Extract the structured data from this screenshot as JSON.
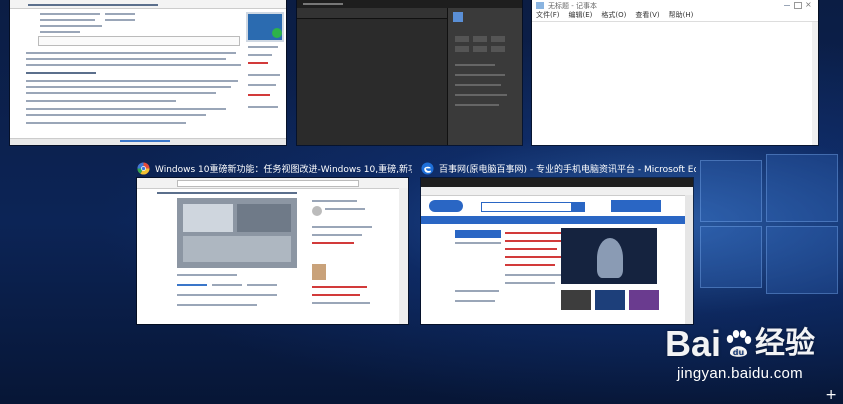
{
  "task_view": {
    "windows": [
      {
        "id": "editor-window",
        "caption": ""
      },
      {
        "id": "photo-editor-window",
        "caption": ""
      },
      {
        "id": "notepad-window",
        "caption": "",
        "title": "无标题 - 记事本",
        "menu": [
          "文件(F)",
          "编辑(E)",
          "格式(O)",
          "查看(V)",
          "帮助(H)"
        ]
      },
      {
        "id": "browser-window-1",
        "caption": "Windows 10重磅新功能：任务视图改进-Windows 10,重磅,新功...",
        "icon": "chrome-style-browser-icon"
      },
      {
        "id": "browser-window-2",
        "caption": "百事网(原电脑百事网) - 专业的手机电脑资讯平台 - Microsoft Ed...",
        "icon": "edge-browser-icon"
      }
    ]
  },
  "watermark": {
    "logo_text": "Bai",
    "logo_text_2": "经验",
    "url": "jingyan.baidu.com"
  },
  "new_desktop": {
    "symbol": "+"
  },
  "colors": {
    "desktop": "#0c2456",
    "edge_blue": "#1e6fd9",
    "pcbeta_blue": "#2a66c4"
  }
}
